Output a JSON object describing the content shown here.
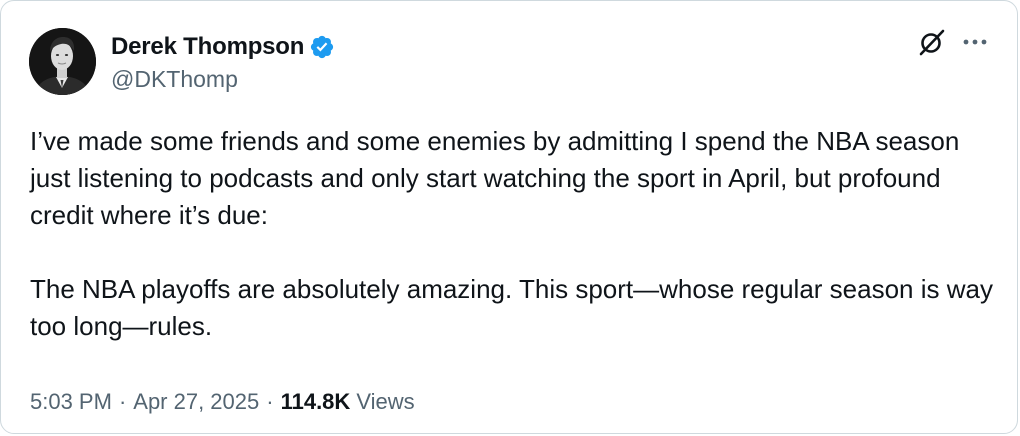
{
  "author": {
    "display_name": "Derek Thompson",
    "handle": "@DKThomp",
    "verified_icon": "verified-badge-icon",
    "avatar_icon": "profile-photo"
  },
  "actions": {
    "grok_icon": "grok-icon",
    "more_icon": "more-options-icon"
  },
  "tweet": {
    "paragraph_1": "I’ve made some friends and some enemies by admitting I spend the NBA season just listening to podcasts and only start watching the sport in April, but profound credit where it’s due:",
    "paragraph_2": "The NBA playoffs are absolutely amazing. This sport—whose regular season is way too long—rules."
  },
  "meta": {
    "time": "5:03 PM",
    "separator": "·",
    "date": "Apr 27, 2025",
    "views_count": "114.8K",
    "views_label": "Views"
  },
  "colors": {
    "text_primary": "#0f1419",
    "text_secondary": "#536471",
    "verified_blue": "#1d9bf0",
    "border": "#cfd9de"
  }
}
